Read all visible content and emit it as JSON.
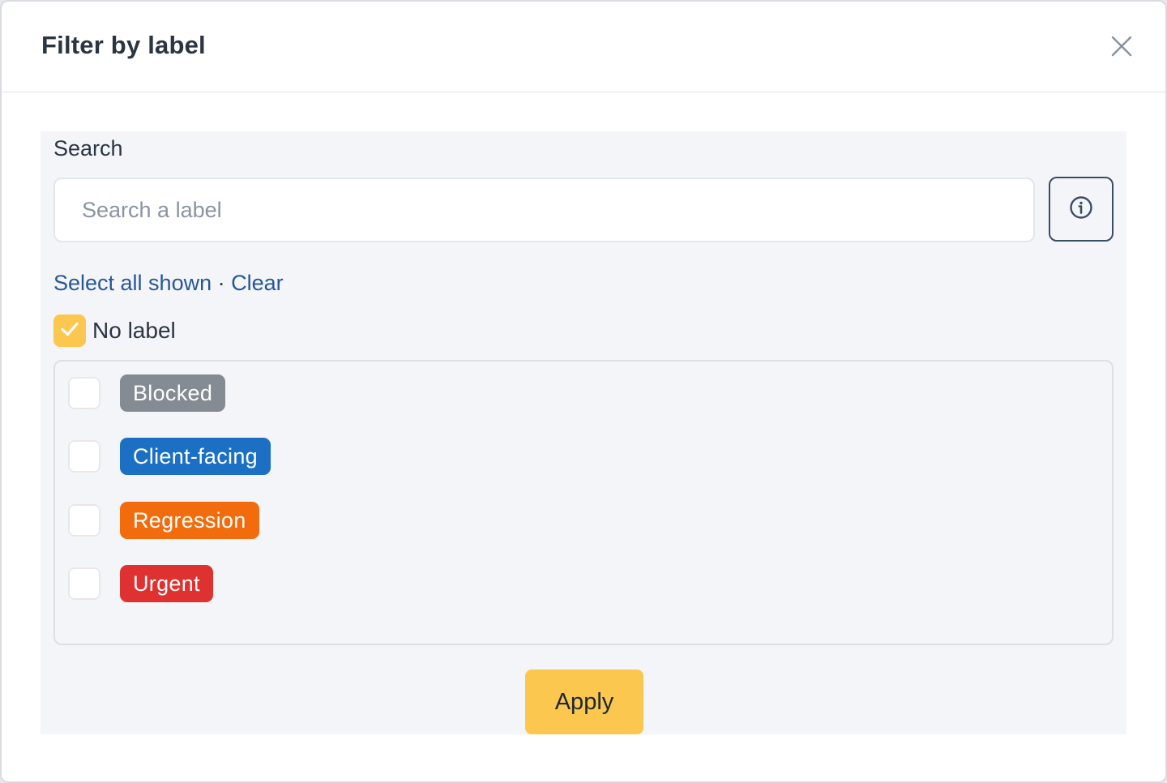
{
  "dialog": {
    "title": "Filter by label",
    "close_icon": "close-icon"
  },
  "search": {
    "label": "Search",
    "placeholder": "Search a label",
    "value": "",
    "info_icon": "info-icon"
  },
  "actions": {
    "select_all": "Select all shown",
    "separator": " · ",
    "clear": "Clear"
  },
  "no_label": {
    "text": "No label",
    "checked": true
  },
  "labels": [
    {
      "name": "Blocked",
      "color": "#858b92",
      "checked": false
    },
    {
      "name": "Client-facing",
      "color": "#1b70c4",
      "checked": false
    },
    {
      "name": "Regression",
      "color": "#f26c0d",
      "checked": false
    },
    {
      "name": "Urgent",
      "color": "#e03131",
      "checked": false
    }
  ],
  "apply_label": "Apply",
  "colors": {
    "accent": "#fcc74f",
    "link": "#27569a"
  }
}
